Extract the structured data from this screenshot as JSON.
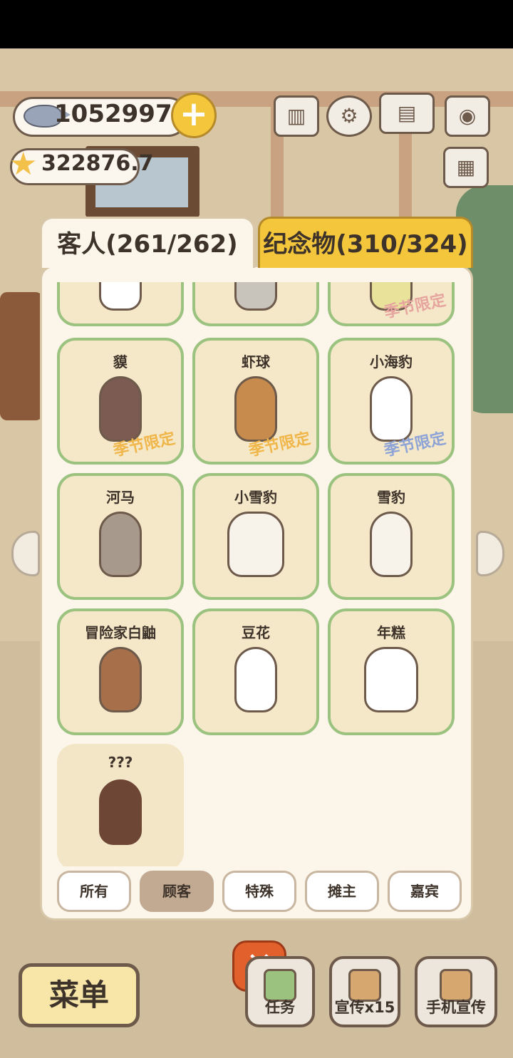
{
  "currency": {
    "fish": "10529974",
    "stars": "322876.7"
  },
  "tabs": {
    "guests": "客人(261/262)",
    "souvenirs": "纪念物(310/324)"
  },
  "season_stamp": "季节限定",
  "cards": [
    {
      "name": "",
      "season": false,
      "stamp_color": ""
    },
    {
      "name": "",
      "season": false,
      "stamp_color": ""
    },
    {
      "name": "",
      "season": true,
      "stamp_color": "#e7a5a0"
    },
    {
      "name": "貘",
      "season": true,
      "stamp_color": "#f0b64a"
    },
    {
      "name": "虾球",
      "season": true,
      "stamp_color": "#f0b64a"
    },
    {
      "name": "小海豹",
      "season": true,
      "stamp_color": "#8ea3d6"
    },
    {
      "name": "河马",
      "season": false,
      "stamp_color": ""
    },
    {
      "name": "小雪豹",
      "season": false,
      "stamp_color": ""
    },
    {
      "name": "雪豹",
      "season": false,
      "stamp_color": ""
    },
    {
      "name": "冒险家白鼬",
      "season": false,
      "stamp_color": ""
    },
    {
      "name": "豆花",
      "season": false,
      "stamp_color": ""
    },
    {
      "name": "年糕",
      "season": false,
      "stamp_color": ""
    },
    {
      "name": "???",
      "season": false,
      "stamp_color": "",
      "locked": true
    }
  ],
  "filters": [
    "所有",
    "顾客",
    "特殊",
    "摊主",
    "嘉宾"
  ],
  "active_filter": "顾客",
  "bottom": {
    "menu": "菜单",
    "tasks": "任务",
    "promote": "宣传x15",
    "phone_promote": "手机宣传"
  },
  "colors": {
    "card_border": "#9bc27f",
    "souvenir_tab": "#f4c63c",
    "close_button": "#e1602c"
  }
}
